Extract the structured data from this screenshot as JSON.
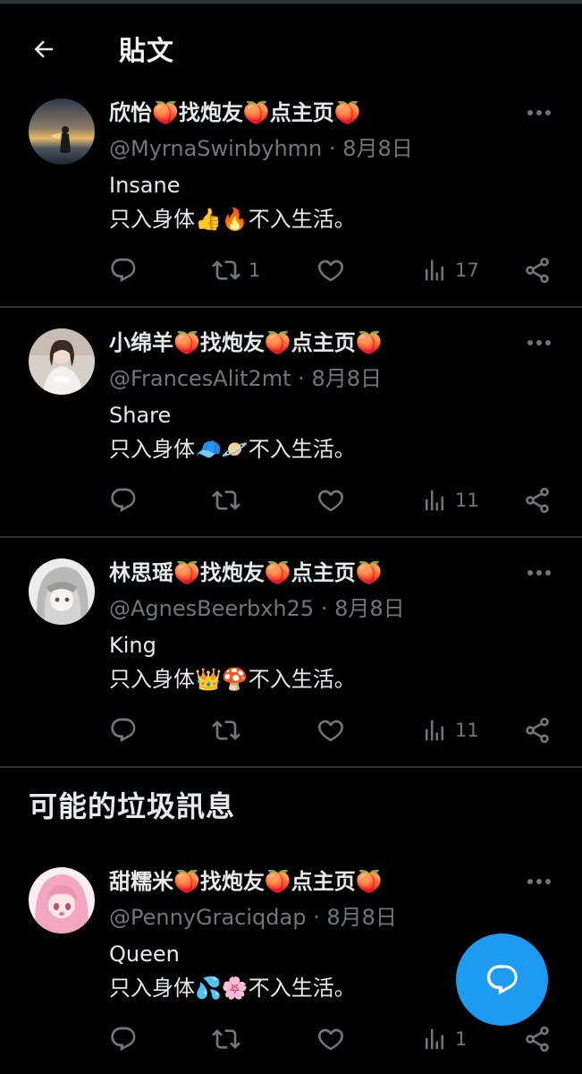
{
  "header": {
    "title": "貼文"
  },
  "tweets": [
    {
      "name": "欣怡🍑找炮友🍑点主页🍑",
      "handle": "@MyrnaSwinbyhmn",
      "date": "8月8日",
      "text_line1": "Insane",
      "text_line2": "只入身体👍🔥不入生活。",
      "reply_count": "",
      "retweet_count": "1",
      "like_count": "",
      "view_count": "17"
    },
    {
      "name": "小绵羊🍑找炮友🍑点主页🍑",
      "handle": "@FrancesAlit2mt",
      "date": "8月8日",
      "text_line1": "Share",
      "text_line2": "只入身体🧢🪐不入生活。",
      "reply_count": "",
      "retweet_count": "",
      "like_count": "",
      "view_count": "11"
    },
    {
      "name": "林思瑶🍑找炮友🍑点主页🍑",
      "handle": "@AgnesBeerbxh25",
      "date": "8月8日",
      "text_line1": "King",
      "text_line2": "只入身体👑🍄不入生活。",
      "reply_count": "",
      "retweet_count": "",
      "like_count": "",
      "view_count": "11"
    },
    {
      "name": "甜糯米🍑找炮友🍑点主页🍑",
      "handle": "@PennyGraciqdap",
      "date": "8月8日",
      "text_line1": "Queen",
      "text_line2": "只入身体💦🌸不入生活。",
      "reply_count": "",
      "retweet_count": "",
      "like_count": "",
      "view_count": "1"
    }
  ],
  "spam_section": {
    "title": "可能的垃圾訊息"
  },
  "meta_separator": "·",
  "colors": {
    "background": "#000000",
    "text": "#e7e9ea",
    "muted": "#71767b",
    "accent": "#1d9bf0",
    "divider": "#2f3336"
  },
  "icons": [
    "back-arrow-icon",
    "more-icon",
    "reply-icon",
    "retweet-icon",
    "like-icon",
    "views-icon",
    "share-icon",
    "compose-reply-icon"
  ]
}
